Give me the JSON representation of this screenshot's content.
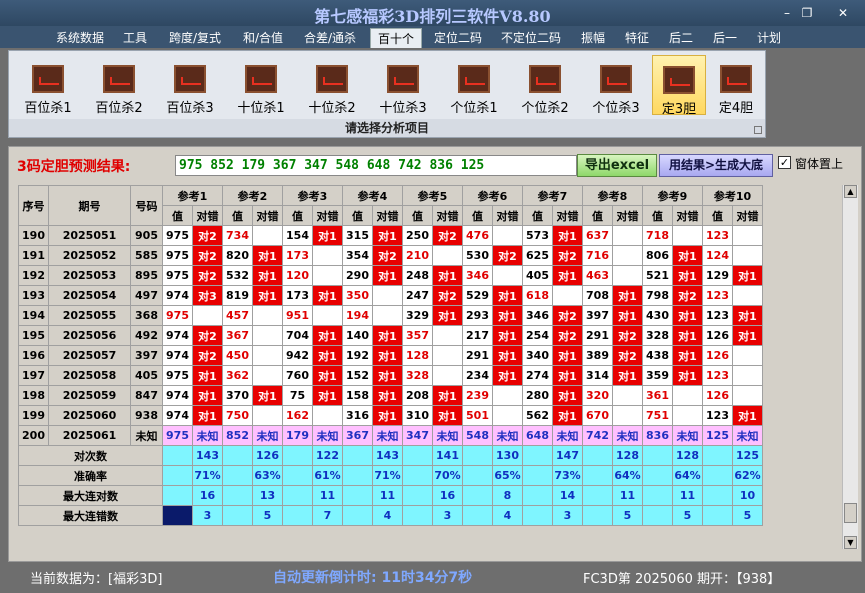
{
  "window": {
    "title": "第七感福彩3D排列三软件V8.80",
    "minimize": "–",
    "restore": "❐",
    "close": "✕"
  },
  "menu": [
    "系统数据",
    "工具",
    "跨度/复式",
    "和/合值",
    "合差/通杀",
    "百十个",
    "定位二码",
    "不定位二码",
    "振幅",
    "特征",
    "后二",
    "后一",
    "计划"
  ],
  "ribbon": {
    "buttons": [
      "百位杀1",
      "百位杀2",
      "百位杀3",
      "十位杀1",
      "十位杀2",
      "十位杀3",
      "个位杀1",
      "个位杀2",
      "个位杀3",
      "定3胆",
      "定4胆"
    ],
    "caption": "请选择分析项目"
  },
  "prediction": {
    "label": "3码定胆预测结果:",
    "value": "975 852 179 367 347 548 648 742 836 125",
    "export_label": "导出excel",
    "generate_label": "用结果>生成大底",
    "checkbox_mark": "✓",
    "pin_label": "窗体置上"
  },
  "table": {
    "headers": {
      "seq": "序号",
      "period": "期号",
      "number": "号码",
      "value": "值",
      "check": "对错"
    },
    "refs": [
      "参考1",
      "参考2",
      "参考3",
      "参考4",
      "参考5",
      "参考6",
      "参考7",
      "参考8",
      "参考9",
      "参考10"
    ],
    "rows": [
      {
        "seq": "190",
        "period": "2025051",
        "num": "905",
        "cells": [
          [
            "975",
            "对2"
          ],
          [
            "734",
            ""
          ],
          [
            "154",
            "对1"
          ],
          [
            "315",
            "对1"
          ],
          [
            "250",
            "对2"
          ],
          [
            "476",
            ""
          ],
          [
            "573",
            "对1"
          ],
          [
            "637",
            ""
          ],
          [
            "718",
            ""
          ],
          [
            "123",
            ""
          ]
        ]
      },
      {
        "seq": "191",
        "period": "2025052",
        "num": "585",
        "cells": [
          [
            "975",
            "对2"
          ],
          [
            "820",
            "对1"
          ],
          [
            "173",
            ""
          ],
          [
            "354",
            "对2"
          ],
          [
            "210",
            ""
          ],
          [
            "530",
            "对2"
          ],
          [
            "625",
            "对2"
          ],
          [
            "716",
            ""
          ],
          [
            "806",
            "对1"
          ],
          [
            "124",
            ""
          ]
        ]
      },
      {
        "seq": "192",
        "period": "2025053",
        "num": "895",
        "cells": [
          [
            "975",
            "对2"
          ],
          [
            "532",
            "对1"
          ],
          [
            "120",
            ""
          ],
          [
            "290",
            "对1"
          ],
          [
            "248",
            "对1"
          ],
          [
            "346",
            ""
          ],
          [
            "405",
            "对1"
          ],
          [
            "463",
            ""
          ],
          [
            "521",
            "对1"
          ],
          [
            "129",
            "对1"
          ]
        ]
      },
      {
        "seq": "193",
        "period": "2025054",
        "num": "497",
        "cells": [
          [
            "974",
            "对3"
          ],
          [
            "819",
            "对1"
          ],
          [
            "173",
            "对1"
          ],
          [
            "350",
            ""
          ],
          [
            "247",
            "对2"
          ],
          [
            "529",
            "对1"
          ],
          [
            "618",
            ""
          ],
          [
            "708",
            "对1"
          ],
          [
            "798",
            "对2"
          ],
          [
            "123",
            ""
          ]
        ]
      },
      {
        "seq": "194",
        "period": "2025055",
        "num": "368",
        "cells": [
          [
            "975",
            ""
          ],
          [
            "457",
            ""
          ],
          [
            "951",
            ""
          ],
          [
            "194",
            ""
          ],
          [
            "329",
            "对1"
          ],
          [
            "293",
            "对1"
          ],
          [
            "346",
            "对2"
          ],
          [
            "397",
            "对1"
          ],
          [
            "430",
            "对1"
          ],
          [
            "123",
            "对1"
          ]
        ]
      },
      {
        "seq": "195",
        "period": "2025056",
        "num": "492",
        "cells": [
          [
            "974",
            "对2"
          ],
          [
            "367",
            ""
          ],
          [
            "704",
            "对1"
          ],
          [
            "140",
            "对1"
          ],
          [
            "357",
            ""
          ],
          [
            "217",
            "对1"
          ],
          [
            "254",
            "对2"
          ],
          [
            "291",
            "对2"
          ],
          [
            "328",
            "对1"
          ],
          [
            "126",
            "对1"
          ]
        ]
      },
      {
        "seq": "196",
        "period": "2025057",
        "num": "397",
        "cells": [
          [
            "974",
            "对2"
          ],
          [
            "450",
            ""
          ],
          [
            "942",
            "对1"
          ],
          [
            "192",
            "对1"
          ],
          [
            "128",
            ""
          ],
          [
            "291",
            "对1"
          ],
          [
            "340",
            "对1"
          ],
          [
            "389",
            "对2"
          ],
          [
            "438",
            "对1"
          ],
          [
            "126",
            ""
          ]
        ]
      },
      {
        "seq": "197",
        "period": "2025058",
        "num": "405",
        "cells": [
          [
            "975",
            "对1"
          ],
          [
            "362",
            ""
          ],
          [
            "760",
            "对1"
          ],
          [
            "152",
            "对1"
          ],
          [
            "328",
            ""
          ],
          [
            "234",
            "对1"
          ],
          [
            "274",
            "对1"
          ],
          [
            "314",
            "对1"
          ],
          [
            "359",
            "对1"
          ],
          [
            "123",
            ""
          ]
        ]
      },
      {
        "seq": "198",
        "period": "2025059",
        "num": "847",
        "cells": [
          [
            "974",
            "对1"
          ],
          [
            "370",
            "对1"
          ],
          [
            "75",
            "对1"
          ],
          [
            "158",
            "对1"
          ],
          [
            "208",
            "对1"
          ],
          [
            "239",
            ""
          ],
          [
            "280",
            "对1"
          ],
          [
            "320",
            ""
          ],
          [
            "361",
            ""
          ],
          [
            "126",
            ""
          ]
        ]
      },
      {
        "seq": "199",
        "period": "2025060",
        "num": "938",
        "cells": [
          [
            "974",
            "对1"
          ],
          [
            "750",
            ""
          ],
          [
            "162",
            ""
          ],
          [
            "316",
            "对1"
          ],
          [
            "310",
            "对1"
          ],
          [
            "501",
            ""
          ],
          [
            "562",
            "对1"
          ],
          [
            "670",
            ""
          ],
          [
            "751",
            ""
          ],
          [
            "123",
            "对1"
          ]
        ]
      }
    ],
    "last_row": {
      "seq": "200",
      "period": "2025061",
      "num": "未知",
      "cells": [
        [
          "975",
          "未知"
        ],
        [
          "852",
          "未知"
        ],
        [
          "179",
          "未知"
        ],
        [
          "367",
          "未知"
        ],
        [
          "347",
          "未知"
        ],
        [
          "548",
          "未知"
        ],
        [
          "648",
          "未知"
        ],
        [
          "742",
          "未知"
        ],
        [
          "836",
          "未知"
        ],
        [
          "125",
          "未知"
        ]
      ]
    },
    "stats": [
      {
        "label": "对次数",
        "values": [
          "143",
          "126",
          "122",
          "143",
          "141",
          "130",
          "147",
          "128",
          "128",
          "125"
        ]
      },
      {
        "label": "准确率",
        "values": [
          "71%",
          "63%",
          "61%",
          "71%",
          "70%",
          "65%",
          "73%",
          "64%",
          "64%",
          "62%"
        ]
      },
      {
        "label": "最大连对数",
        "values": [
          "16",
          "13",
          "11",
          "11",
          "16",
          "8",
          "14",
          "11",
          "11",
          "10"
        ]
      },
      {
        "label": "最大连错数",
        "values": [
          "3",
          "5",
          "7",
          "4",
          "3",
          "4",
          "3",
          "5",
          "5",
          "5"
        ]
      }
    ]
  },
  "status": {
    "current_data": "当前数据为：[福彩3D]",
    "countdown": "自动更新倒计时:  11时34分7秒",
    "issue": "FC3D第 2025060 期开：【938】"
  },
  "colors": {
    "hit": "#e80000",
    "stat_bg": "#7ff5ff",
    "unknown_bg": "#ffc0ff"
  }
}
